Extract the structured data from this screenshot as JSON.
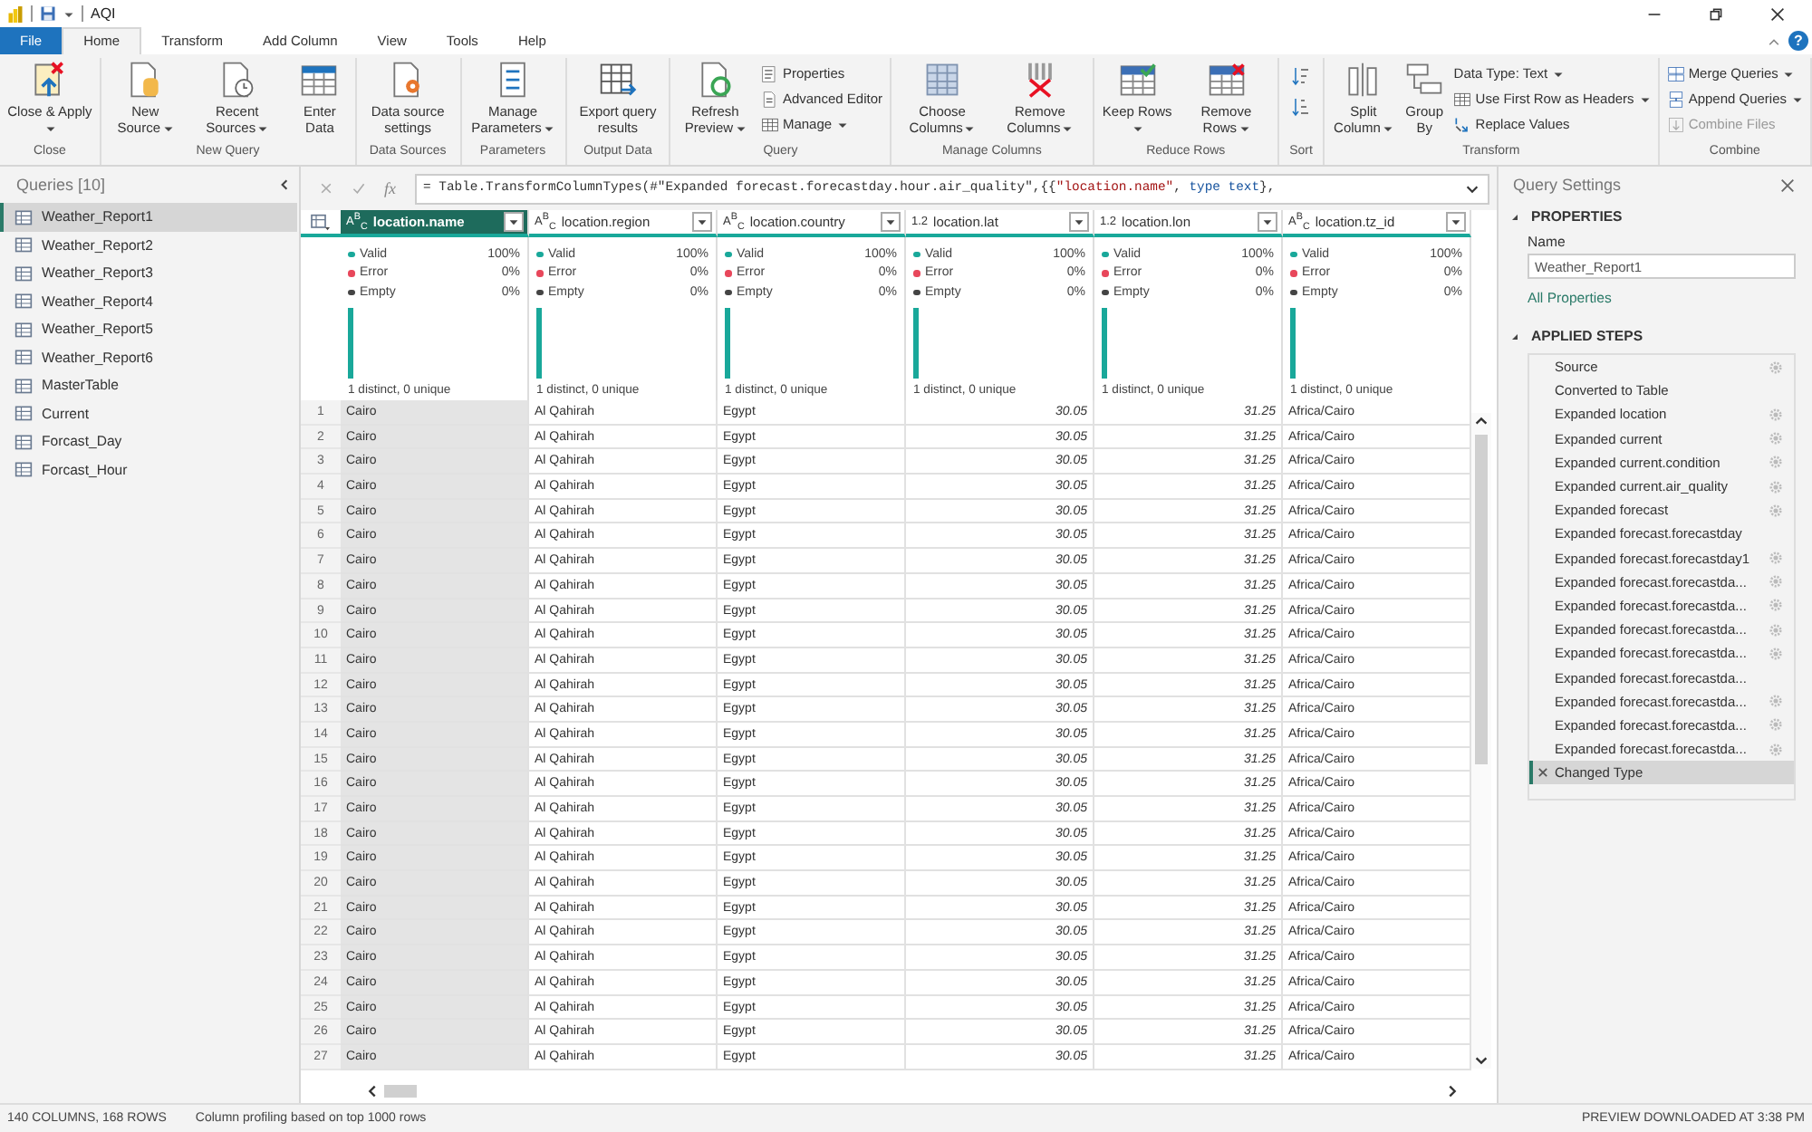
{
  "title_bar": {
    "title": "AQI"
  },
  "help": "?",
  "tabs": [
    {
      "label": "File",
      "kind": "file",
      "selected": false
    },
    {
      "label": "Home",
      "kind": "tab",
      "selected": true
    },
    {
      "label": "Transform",
      "kind": "tab",
      "selected": false
    },
    {
      "label": "Add Column",
      "kind": "tab",
      "selected": false
    },
    {
      "label": "View",
      "kind": "tab",
      "selected": false
    },
    {
      "label": "Tools",
      "kind": "tab",
      "selected": false
    },
    {
      "label": "Help",
      "kind": "tab",
      "selected": false
    }
  ],
  "ribbon": {
    "groups": [
      {
        "label": "Close",
        "items": [
          {
            "kind": "large",
            "label": "Close & Apply",
            "dropdown": true,
            "disabled": false
          }
        ]
      },
      {
        "label": "New Query",
        "items": [
          {
            "kind": "large",
            "label": "New Source",
            "dropdown": true,
            "disabled": false
          },
          {
            "kind": "large",
            "label": "Recent Sources",
            "dropdown": true,
            "disabled": false
          },
          {
            "kind": "large",
            "label": "Enter Data",
            "dropdown": false,
            "disabled": false
          }
        ]
      },
      {
        "label": "Data Sources",
        "items": [
          {
            "kind": "large",
            "label": "Data source settings",
            "dropdown": false,
            "disabled": false
          }
        ]
      },
      {
        "label": "Parameters",
        "items": [
          {
            "kind": "large",
            "label": "Manage Parameters",
            "dropdown": true,
            "disabled": false
          }
        ]
      },
      {
        "label": "Output Data",
        "items": [
          {
            "kind": "large",
            "label": "Export query results",
            "dropdown": false,
            "disabled": false
          }
        ]
      },
      {
        "label": "Query",
        "items": [
          {
            "kind": "large",
            "label": "Refresh Preview",
            "dropdown": true,
            "disabled": false
          },
          {
            "kind": "small",
            "label": "Properties",
            "dropdown": false,
            "disabled": false
          },
          {
            "kind": "small",
            "label": "Advanced Editor",
            "dropdown": false,
            "disabled": false
          },
          {
            "kind": "small",
            "label": "Manage",
            "dropdown": true,
            "disabled": false
          }
        ]
      },
      {
        "label": "Manage Columns",
        "items": [
          {
            "kind": "large",
            "label": "Choose Columns",
            "dropdown": true,
            "disabled": false
          },
          {
            "kind": "large",
            "label": "Remove Columns",
            "dropdown": true,
            "disabled": false
          }
        ]
      },
      {
        "label": "Reduce Rows",
        "items": [
          {
            "kind": "large",
            "label": "Keep Rows",
            "dropdown": true,
            "disabled": false
          },
          {
            "kind": "large",
            "label": "Remove Rows",
            "dropdown": true,
            "disabled": false
          }
        ]
      },
      {
        "label": "Sort",
        "items": [
          {
            "kind": "icon",
            "disabled": false
          },
          {
            "kind": "icon",
            "disabled": false
          }
        ]
      },
      {
        "label": "Transform",
        "items": [
          {
            "kind": "large",
            "label": "Split Column",
            "dropdown": true,
            "disabled": false
          },
          {
            "kind": "large",
            "label": "Group By",
            "dropdown": false,
            "disabled": false
          },
          {
            "kind": "small",
            "label": "Data Type: Text",
            "dropdown": true,
            "disabled": false
          },
          {
            "kind": "small",
            "label": "Use First Row as Headers",
            "dropdown": true,
            "disabled": false
          },
          {
            "kind": "small",
            "label": "Replace Values",
            "dropdown": false,
            "disabled": false
          }
        ]
      },
      {
        "label": "Combine",
        "items": [
          {
            "kind": "small",
            "label": "Merge Queries",
            "dropdown": true,
            "disabled": false
          },
          {
            "kind": "small",
            "label": "Append Queries",
            "dropdown": true,
            "disabled": false
          },
          {
            "kind": "small",
            "label": "Combine Files",
            "dropdown": false,
            "disabled": true
          }
        ]
      }
    ]
  },
  "queries": {
    "title": "Queries [10]",
    "items": [
      {
        "label": "Weather_Report1",
        "selected": true
      },
      {
        "label": "Weather_Report2",
        "selected": false
      },
      {
        "label": "Weather_Report3",
        "selected": false
      },
      {
        "label": "Weather_Report4",
        "selected": false
      },
      {
        "label": "Weather_Report5",
        "selected": false
      },
      {
        "label": "Weather_Report6",
        "selected": false
      },
      {
        "label": "MasterTable",
        "selected": false
      },
      {
        "label": "Current",
        "selected": false
      },
      {
        "label": "Forcast_Day",
        "selected": false
      },
      {
        "label": "Forcast_Hour",
        "selected": false
      }
    ]
  },
  "formula": {
    "fx": "fx",
    "segments": [
      {
        "kind": "plain",
        "text": "= Table.TransformColumnTypes(#\"Expanded forecast.forecastday.hour.air_quality\",{{"
      },
      {
        "kind": "string",
        "text": "\"location.name\""
      },
      {
        "kind": "plain",
        "text": ", "
      },
      {
        "kind": "keyword",
        "text": "type text"
      },
      {
        "kind": "plain",
        "text": "},"
      }
    ]
  },
  "table": {
    "columns": [
      {
        "kind": "text",
        "type_label": "A$^{B}$$_{C}$",
        "name": "location.name",
        "selected": true,
        "valid_label": "Valid",
        "valid": "100%",
        "error_label": "Error",
        "error": "0%",
        "empty_label": "Empty",
        "empty": "0%",
        "summary": "1 distinct, 0 unique"
      },
      {
        "kind": "text",
        "type_label": "A$^{B}$$_{C}$",
        "name": "location.region",
        "selected": false,
        "valid_label": "Valid",
        "valid": "100%",
        "error_label": "Error",
        "error": "0%",
        "empty_label": "Empty",
        "empty": "0%",
        "summary": "1 distinct, 0 unique"
      },
      {
        "kind": "text",
        "type_label": "A$^{B}$$_{C}$",
        "name": "location.country",
        "selected": false,
        "valid_label": "Valid",
        "valid": "100%",
        "error_label": "Error",
        "error": "0%",
        "empty_label": "Empty",
        "empty": "0%",
        "summary": "1 distinct, 0 unique"
      },
      {
        "kind": "decimal",
        "type_label": "1.2",
        "name": "location.lat",
        "selected": false,
        "valid_label": "Valid",
        "valid": "100%",
        "error_label": "Error",
        "error": "0%",
        "empty_label": "Empty",
        "empty": "0%",
        "summary": "1 distinct, 0 unique"
      },
      {
        "kind": "decimal",
        "type_label": "1.2",
        "name": "location.lon",
        "selected": false,
        "valid_label": "Valid",
        "valid": "100%",
        "error_label": "Error",
        "error": "0%",
        "empty_label": "Empty",
        "empty": "0%",
        "summary": "1 distinct, 0 unique"
      },
      {
        "kind": "text",
        "type_label": "A$^{B}$$_{C}$",
        "name": "location.tz_id",
        "selected": false,
        "valid_label": "Valid",
        "valid": "100%",
        "error_label": "Error",
        "error": "0%",
        "empty_label": "Empty",
        "empty": "0%",
        "summary": "1 distinct, 0 unique"
      }
    ],
    "rows": [
      {
        "number": "1",
        "cells": [
          "Cairo",
          "Al Qahirah",
          "Egypt",
          "30.05",
          "31.25",
          "Africa/Cairo"
        ]
      },
      {
        "number": "2",
        "cells": [
          "Cairo",
          "Al Qahirah",
          "Egypt",
          "30.05",
          "31.25",
          "Africa/Cairo"
        ]
      },
      {
        "number": "3",
        "cells": [
          "Cairo",
          "Al Qahirah",
          "Egypt",
          "30.05",
          "31.25",
          "Africa/Cairo"
        ]
      },
      {
        "number": "4",
        "cells": [
          "Cairo",
          "Al Qahirah",
          "Egypt",
          "30.05",
          "31.25",
          "Africa/Cairo"
        ]
      },
      {
        "number": "5",
        "cells": [
          "Cairo",
          "Al Qahirah",
          "Egypt",
          "30.05",
          "31.25",
          "Africa/Cairo"
        ]
      },
      {
        "number": "6",
        "cells": [
          "Cairo",
          "Al Qahirah",
          "Egypt",
          "30.05",
          "31.25",
          "Africa/Cairo"
        ]
      },
      {
        "number": "7",
        "cells": [
          "Cairo",
          "Al Qahirah",
          "Egypt",
          "30.05",
          "31.25",
          "Africa/Cairo"
        ]
      },
      {
        "number": "8",
        "cells": [
          "Cairo",
          "Al Qahirah",
          "Egypt",
          "30.05",
          "31.25",
          "Africa/Cairo"
        ]
      },
      {
        "number": "9",
        "cells": [
          "Cairo",
          "Al Qahirah",
          "Egypt",
          "30.05",
          "31.25",
          "Africa/Cairo"
        ]
      },
      {
        "number": "10",
        "cells": [
          "Cairo",
          "Al Qahirah",
          "Egypt",
          "30.05",
          "31.25",
          "Africa/Cairo"
        ]
      },
      {
        "number": "11",
        "cells": [
          "Cairo",
          "Al Qahirah",
          "Egypt",
          "30.05",
          "31.25",
          "Africa/Cairo"
        ]
      },
      {
        "number": "12",
        "cells": [
          "Cairo",
          "Al Qahirah",
          "Egypt",
          "30.05",
          "31.25",
          "Africa/Cairo"
        ]
      },
      {
        "number": "13",
        "cells": [
          "Cairo",
          "Al Qahirah",
          "Egypt",
          "30.05",
          "31.25",
          "Africa/Cairo"
        ]
      },
      {
        "number": "14",
        "cells": [
          "Cairo",
          "Al Qahirah",
          "Egypt",
          "30.05",
          "31.25",
          "Africa/Cairo"
        ]
      },
      {
        "number": "15",
        "cells": [
          "Cairo",
          "Al Qahirah",
          "Egypt",
          "30.05",
          "31.25",
          "Africa/Cairo"
        ]
      },
      {
        "number": "16",
        "cells": [
          "Cairo",
          "Al Qahirah",
          "Egypt",
          "30.05",
          "31.25",
          "Africa/Cairo"
        ]
      },
      {
        "number": "17",
        "cells": [
          "Cairo",
          "Al Qahirah",
          "Egypt",
          "30.05",
          "31.25",
          "Africa/Cairo"
        ]
      },
      {
        "number": "18",
        "cells": [
          "Cairo",
          "Al Qahirah",
          "Egypt",
          "30.05",
          "31.25",
          "Africa/Cairo"
        ]
      },
      {
        "number": "19",
        "cells": [
          "Cairo",
          "Al Qahirah",
          "Egypt",
          "30.05",
          "31.25",
          "Africa/Cairo"
        ]
      },
      {
        "number": "20",
        "cells": [
          "Cairo",
          "Al Qahirah",
          "Egypt",
          "30.05",
          "31.25",
          "Africa/Cairo"
        ]
      },
      {
        "number": "21",
        "cells": [
          "Cairo",
          "Al Qahirah",
          "Egypt",
          "30.05",
          "31.25",
          "Africa/Cairo"
        ]
      },
      {
        "number": "22",
        "cells": [
          "Cairo",
          "Al Qahirah",
          "Egypt",
          "30.05",
          "31.25",
          "Africa/Cairo"
        ]
      },
      {
        "number": "23",
        "cells": [
          "Cairo",
          "Al Qahirah",
          "Egypt",
          "30.05",
          "31.25",
          "Africa/Cairo"
        ]
      },
      {
        "number": "24",
        "cells": [
          "Cairo",
          "Al Qahirah",
          "Egypt",
          "30.05",
          "31.25",
          "Africa/Cairo"
        ]
      },
      {
        "number": "25",
        "cells": [
          "Cairo",
          "Al Qahirah",
          "Egypt",
          "30.05",
          "31.25",
          "Africa/Cairo"
        ]
      },
      {
        "number": "26",
        "cells": [
          "Cairo",
          "Al Qahirah",
          "Egypt",
          "30.05",
          "31.25",
          "Africa/Cairo"
        ]
      },
      {
        "number": "27",
        "cells": [
          "Cairo",
          "Al Qahirah",
          "Egypt",
          "30.05",
          "31.25",
          "Africa/Cairo"
        ]
      }
    ]
  },
  "settings": {
    "title": "Query Settings",
    "properties_heading": "PROPERTIES",
    "name_label": "Name",
    "name_value": "Weather_Report1",
    "all_properties": "All Properties",
    "steps_heading": "APPLIED STEPS",
    "steps": [
      {
        "label": "Source",
        "gear": true,
        "selected": false
      },
      {
        "label": "Converted to Table",
        "gear": false,
        "selected": false
      },
      {
        "label": "Expanded location",
        "gear": true,
        "selected": false
      },
      {
        "label": "Expanded current",
        "gear": true,
        "selected": false
      },
      {
        "label": "Expanded current.condition",
        "gear": true,
        "selected": false
      },
      {
        "label": "Expanded current.air_quality",
        "gear": true,
        "selected": false
      },
      {
        "label": "Expanded forecast",
        "gear": true,
        "selected": false
      },
      {
        "label": "Expanded forecast.forecastday",
        "gear": false,
        "selected": false
      },
      {
        "label": "Expanded forecast.forecastday1",
        "gear": true,
        "selected": false
      },
      {
        "label": "Expanded forecast.forecastda...",
        "gear": true,
        "selected": false
      },
      {
        "label": "Expanded forecast.forecastda...",
        "gear": true,
        "selected": false
      },
      {
        "label": "Expanded forecast.forecastda...",
        "gear": true,
        "selected": false
      },
      {
        "label": "Expanded forecast.forecastda...",
        "gear": true,
        "selected": false
      },
      {
        "label": "Expanded forecast.forecastda...",
        "gear": false,
        "selected": false
      },
      {
        "label": "Expanded forecast.forecastda...",
        "gear": true,
        "selected": false
      },
      {
        "label": "Expanded forecast.forecastda...",
        "gear": true,
        "selected": false
      },
      {
        "label": "Expanded forecast.forecastda...",
        "gear": true,
        "selected": false
      },
      {
        "label": "Changed Type",
        "gear": false,
        "selected": true
      }
    ]
  },
  "status_bar": {
    "left": "140 COLUMNS, 168 ROWS",
    "middle": "Column profiling based on top 1000 rows",
    "right": "PREVIEW DOWNLOADED AT 3:38 PM"
  }
}
